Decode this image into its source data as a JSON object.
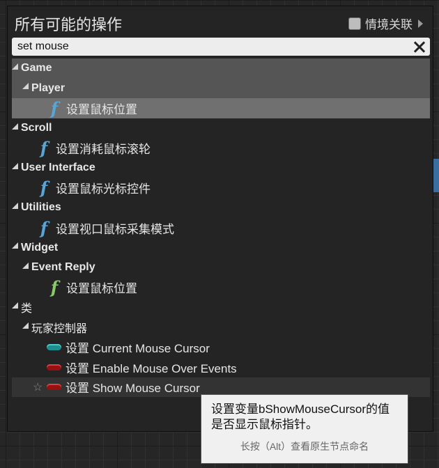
{
  "header": {
    "title": "所有可能的操作",
    "context_label": "情境关联"
  },
  "search": {
    "value": "set mouse"
  },
  "tree": {
    "game": "Game",
    "player": "Player",
    "player_item": "设置鼠标位置",
    "scroll": "Scroll",
    "scroll_item": "设置消耗鼠标滚轮",
    "ui": "User Interface",
    "ui_item": "设置鼠标光标控件",
    "utilities": "Utilities",
    "utilities_item": "设置视口鼠标采集模式",
    "widget": "Widget",
    "event_reply": "Event Reply",
    "event_reply_item": "设置鼠标位置",
    "class": "类",
    "player_controller": "玩家控制器",
    "pc_item1": "设置 Current Mouse Cursor",
    "pc_item2": "设置 Enable Mouse Over Events",
    "pc_item3": "设置 Show Mouse Cursor"
  },
  "tooltip": {
    "line1": "设置变量bShowMouseCursor的值",
    "line2": "是否显示鼠标指针。",
    "hint": "长按（Alt）查看原生节点命名"
  },
  "colors": {
    "function_blue": "#58a6d8",
    "function_green": "#88c968",
    "pin_teal": "#1d8f8f",
    "pin_red": "#9a1010"
  }
}
